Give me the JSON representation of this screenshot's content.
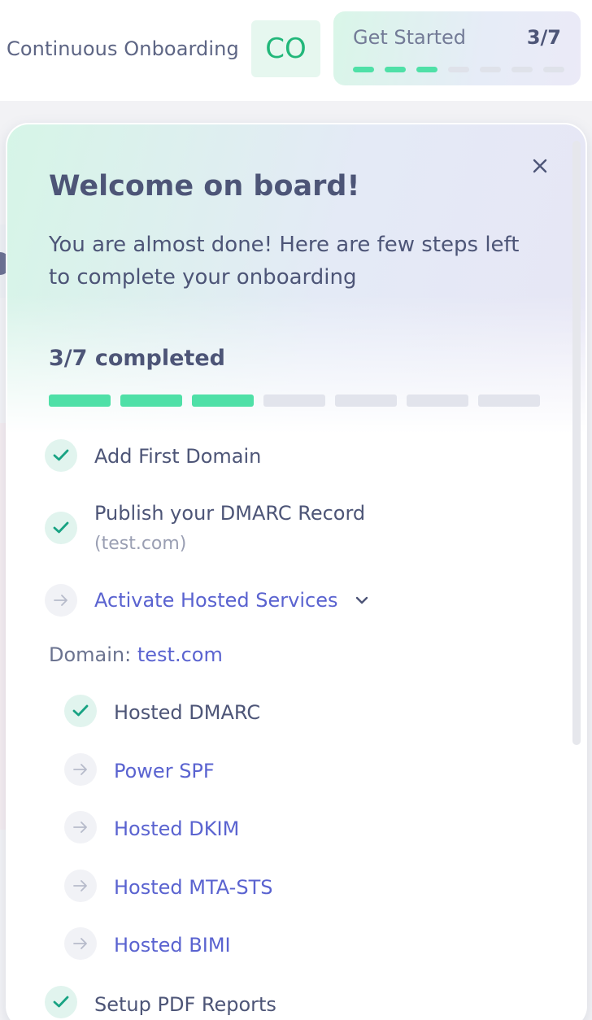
{
  "header": {
    "org_name": "Continuous Onboarding",
    "org_initials": "CO",
    "get_started": {
      "title": "Get Started",
      "count": "3/7",
      "completed_steps": 3,
      "total_steps": 7
    }
  },
  "panel": {
    "title": "Welcome on board!",
    "subtitle": "You are almost done! Here are few steps left to complete your onboarding",
    "completed_label": "3/7 completed",
    "completed_steps": 3,
    "total_steps": 7,
    "steps": [
      {
        "label": "Add First Domain",
        "status": "done"
      },
      {
        "label": "Publish your DMARC Record",
        "detail": "(test.com)",
        "status": "done"
      },
      {
        "label": "Activate Hosted Services",
        "status": "pending",
        "expanded": true
      }
    ],
    "domain_prefix": "Domain:",
    "domain": "test.com",
    "substeps": [
      {
        "label": "Hosted DMARC",
        "status": "done"
      },
      {
        "label": "Power SPF",
        "status": "pending"
      },
      {
        "label": "Hosted DKIM",
        "status": "pending"
      },
      {
        "label": "Hosted MTA-STS",
        "status": "pending"
      },
      {
        "label": "Hosted BIMI",
        "status": "pending"
      }
    ],
    "next_step": {
      "label": "Setup PDF Reports",
      "status": "done"
    }
  },
  "colors": {
    "accent_green": "#4fe0a7",
    "link_blue": "#5a63d0",
    "text_dark": "#4d5577"
  },
  "icons": {
    "check": "check-icon",
    "arrow": "arrow-right-icon",
    "chevron": "chevron-down-icon",
    "close": "close-icon"
  }
}
